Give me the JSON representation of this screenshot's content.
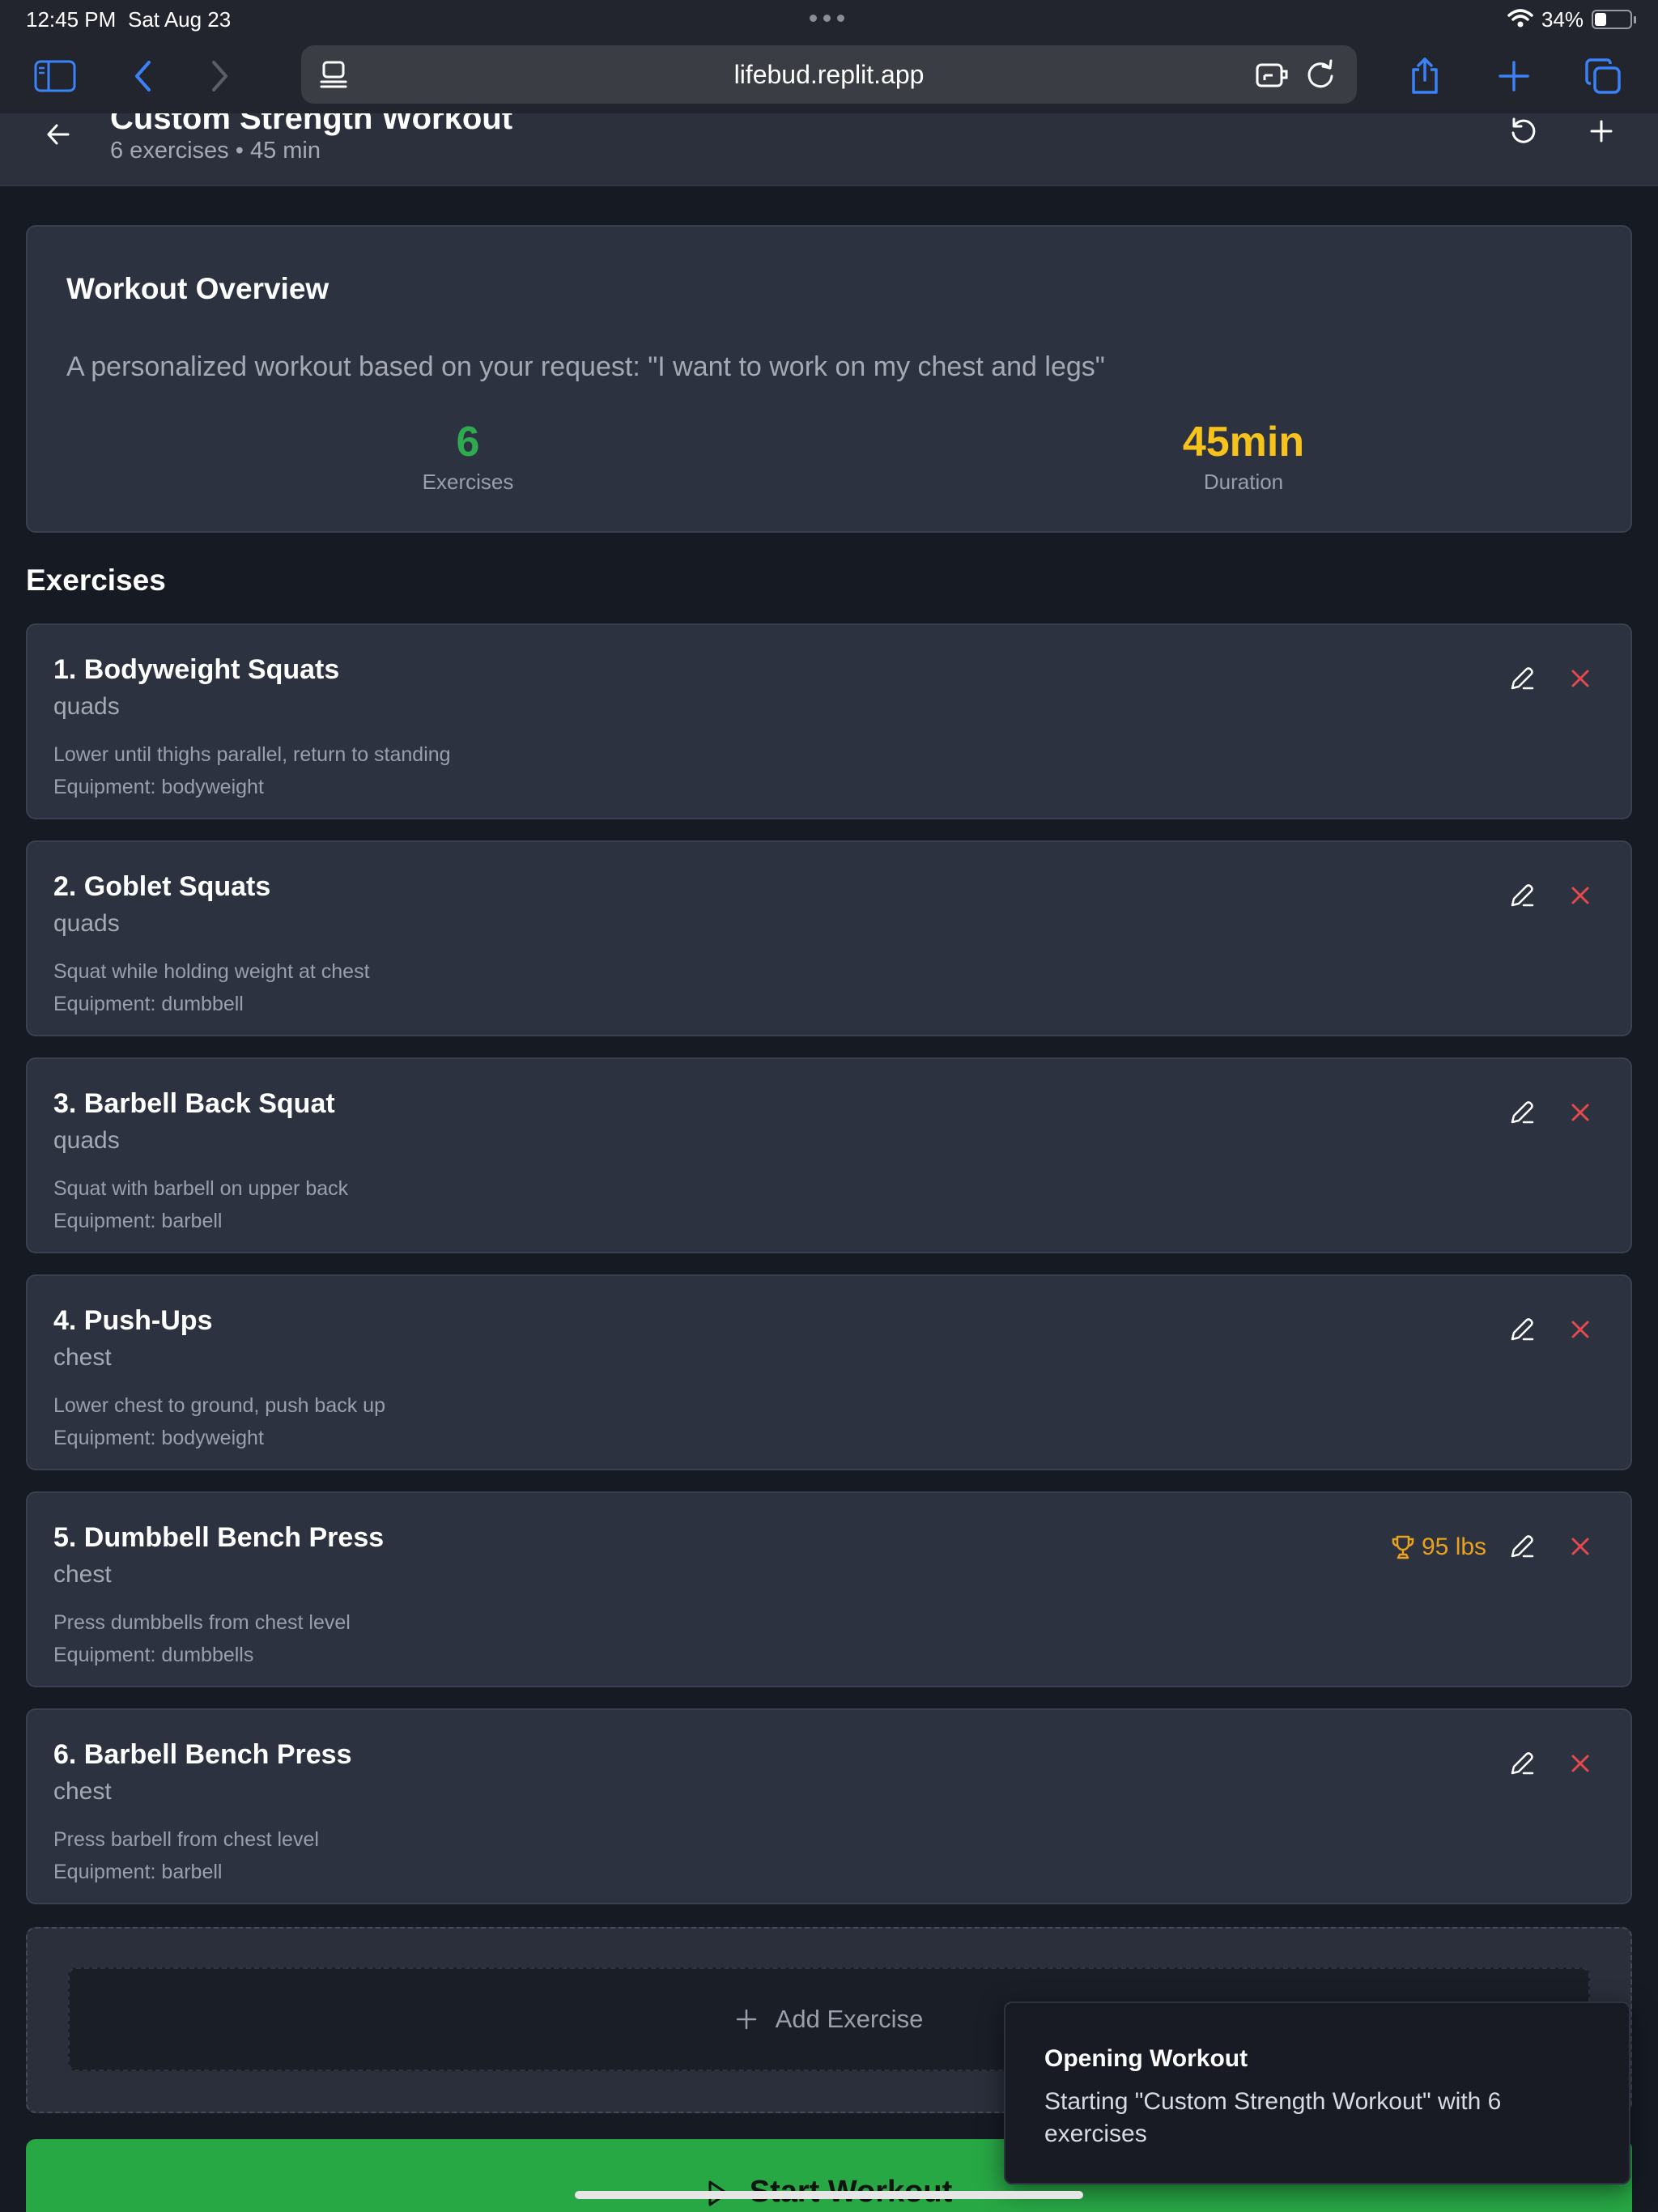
{
  "status_bar": {
    "time": "12:45 PM",
    "date": "Sat Aug 23",
    "battery": "34%",
    "battery_level": 0.34
  },
  "browser": {
    "url": "lifebud.replit.app"
  },
  "header": {
    "title": "Custom Strength Workout",
    "subtitle": "6 exercises • 45 min"
  },
  "overview": {
    "title": "Workout Overview",
    "description": "A personalized workout based on your request: \"I want to work on my chest and legs\"",
    "exercises_value": "6",
    "exercises_label": "Exercises",
    "duration_value": "45min",
    "duration_label": "Duration"
  },
  "exercises_section_title": "Exercises",
  "exercises": [
    {
      "name": "1. Bodyweight Squats",
      "muscle": "quads",
      "description": "Lower until thighs parallel, return to standing",
      "equipment": "Equipment: bodyweight"
    },
    {
      "name": "2. Goblet Squats",
      "muscle": "quads",
      "description": "Squat while holding weight at chest",
      "equipment": "Equipment: dumbbell"
    },
    {
      "name": "3. Barbell Back Squat",
      "muscle": "quads",
      "description": "Squat with barbell on upper back",
      "equipment": "Equipment: barbell"
    },
    {
      "name": "4. Push-Ups",
      "muscle": "chest",
      "description": "Lower chest to ground, push back up",
      "equipment": "Equipment: bodyweight"
    },
    {
      "name": "5. Dumbbell Bench Press",
      "muscle": "chest",
      "description": "Press dumbbells from chest level",
      "equipment": "Equipment: dumbbells",
      "pr": "95 lbs"
    },
    {
      "name": "6. Barbell Bench Press",
      "muscle": "chest",
      "description": "Press barbell from chest level",
      "equipment": "Equipment: barbell"
    }
  ],
  "add_exercise_label": "Add Exercise",
  "start_workout_label": "Start Workout",
  "toast": {
    "title": "Opening Workout",
    "message": "Starting \"Custom Strength Workout\" with 6 exercises"
  },
  "colors": {
    "accent_green": "#28a745",
    "accent_yellow": "#f6c21c",
    "delete_red": "#e5484d",
    "safari_blue": "#3b82f6"
  }
}
